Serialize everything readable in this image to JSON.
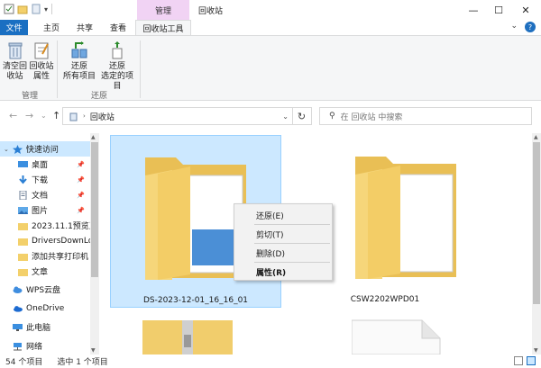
{
  "window": {
    "title": "回收站",
    "context_tab": "管理"
  },
  "tabs": [
    {
      "label": "文件"
    },
    {
      "label": "主页"
    },
    {
      "label": "共享"
    },
    {
      "label": "查看"
    },
    {
      "label": "回收站工具"
    }
  ],
  "ribbon": {
    "buttons": [
      {
        "label": "清空回\n收站"
      },
      {
        "label": "回收站\n属性"
      },
      {
        "label": "还原\n所有项目"
      },
      {
        "label": "还原\n选定的项目"
      }
    ],
    "groups": [
      {
        "label": "管理"
      },
      {
        "label": "还原"
      }
    ]
  },
  "address": {
    "path": "回收站",
    "search_placeholder": "在 回收站 中搜索"
  },
  "sidebar": {
    "items": [
      {
        "label": "快速访问",
        "icon": "star-icon"
      },
      {
        "label": "桌面",
        "icon": "desktop-icon",
        "pinned": true
      },
      {
        "label": "下载",
        "icon": "download-icon",
        "pinned": true
      },
      {
        "label": "文档",
        "icon": "document-icon",
        "pinned": true
      },
      {
        "label": "图片",
        "icon": "picture-icon",
        "pinned": true
      },
      {
        "label": "2023.11.1预览正",
        "icon": "folder-icon"
      },
      {
        "label": "DriversDownLo",
        "icon": "folder-icon"
      },
      {
        "label": "添加共享打印机",
        "icon": "folder-icon"
      },
      {
        "label": "文章",
        "icon": "folder-icon"
      },
      {
        "label": "WPS云盘",
        "icon": "cloud-icon"
      },
      {
        "label": "OneDrive",
        "icon": "onedrive-icon"
      },
      {
        "label": "此电脑",
        "icon": "computer-icon"
      },
      {
        "label": "网络",
        "icon": "network-icon"
      }
    ]
  },
  "files": [
    {
      "name": "DS-2023-12-01_16_16_01",
      "selected": true
    },
    {
      "name": "CSW2202WPD01",
      "selected": false
    }
  ],
  "context_menu": {
    "items": [
      {
        "label": "还原(E)"
      },
      {
        "label": "剪切(T)"
      },
      {
        "label": "删除(D)"
      },
      {
        "label": "属性(R)"
      }
    ]
  },
  "status": {
    "count": "54 个项目",
    "selected": "选中 1 个项目"
  },
  "colors": {
    "accent": "#1a6fc2",
    "selection": "#cce8ff",
    "context_tab": "#f1d3f4",
    "folder": "#f6d67a"
  }
}
